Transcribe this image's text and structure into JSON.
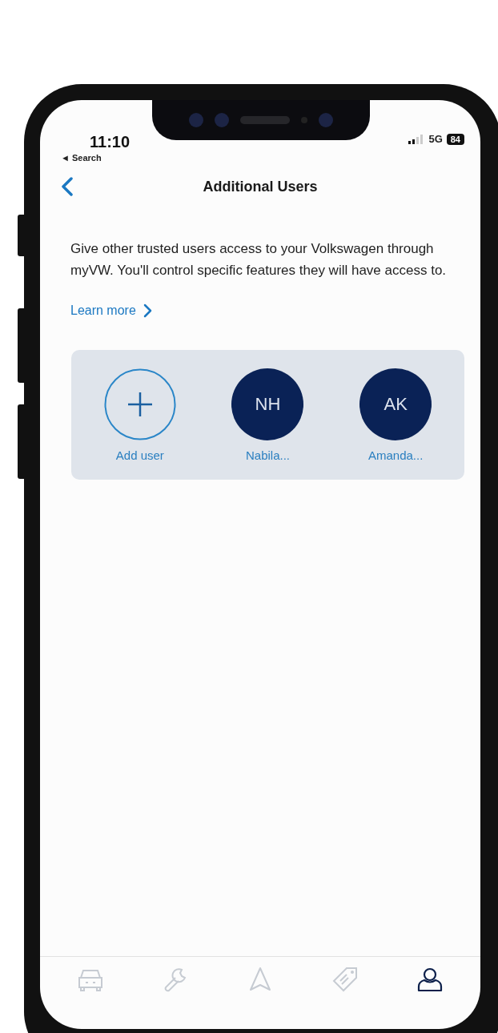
{
  "status_bar": {
    "time": "11:10",
    "back_label": "◄ Search",
    "network": "5G",
    "battery": "84"
  },
  "header": {
    "title": "Additional Users"
  },
  "intro": "Give other trusted users access to your Volkswagen through myVW. You'll control specific features they will have access to.",
  "learn_more": "Learn more",
  "users": [
    {
      "kind": "add",
      "label": "Add user"
    },
    {
      "kind": "user",
      "initials": "NH",
      "label": "Nabila..."
    },
    {
      "kind": "user",
      "initials": "AK",
      "label": "Amanda..."
    }
  ],
  "tab_bar": [
    {
      "selected": false
    },
    {
      "selected": false
    },
    {
      "selected": false
    },
    {
      "selected": false
    },
    {
      "selected": true
    }
  ]
}
